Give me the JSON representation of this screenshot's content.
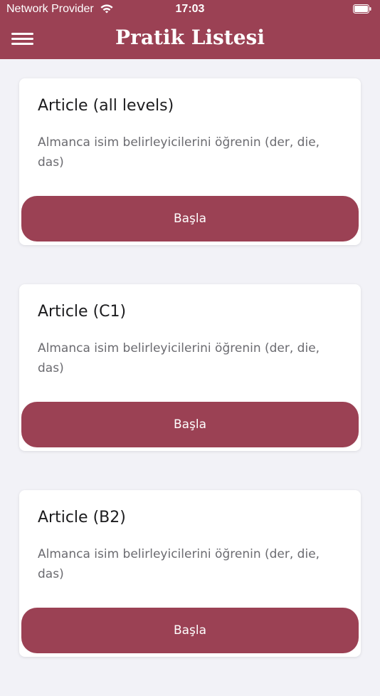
{
  "status_bar": {
    "carrier": "Network Provider",
    "time": "17:03",
    "icons": [
      "wifi-icon",
      "battery-icon"
    ]
  },
  "nav": {
    "title": "Pratik Listesi",
    "menu_icon": "hamburger-menu-icon"
  },
  "colors": {
    "brand": "#9b4154",
    "background": "#f2f2f7",
    "card": "#ffffff",
    "title_text": "#1c1c1e",
    "desc_text": "#6b6b70"
  },
  "cards": [
    {
      "title": "Article (all levels)",
      "description": "Almanca isim belirleyicilerini öğrenin (der, die, das)",
      "button_label": "Başla"
    },
    {
      "title": "Article (C1)",
      "description": "Almanca isim belirleyicilerini öğrenin (der, die, das)",
      "button_label": "Başla"
    },
    {
      "title": "Article (B2)",
      "description": "Almanca isim belirleyicilerini öğrenin (der, die, das)",
      "button_label": "Başla"
    }
  ]
}
